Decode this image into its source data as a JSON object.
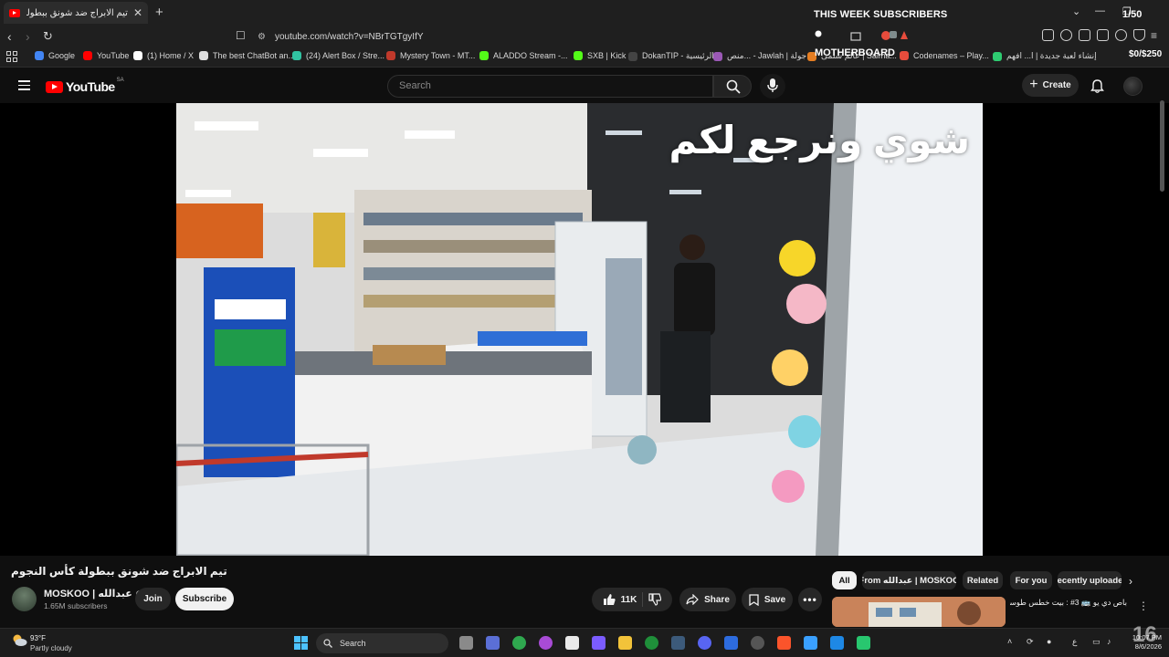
{
  "browser": {
    "tab_title": "تيم الابراج ضد شونق ببطولة كأس",
    "url": "youtube.com/watch?v=NBrTGTgyIfY",
    "bookmarks": [
      {
        "label": "Google",
        "color": "#4285f4"
      },
      {
        "label": "YouTube",
        "color": "#ff0000"
      },
      {
        "label": "(1) Home / X",
        "color": "#ffffff"
      },
      {
        "label": "The best ChatBot an...",
        "color": "#dddddd"
      },
      {
        "label": "(24) Alert Box / Stre...",
        "color": "#31c3a2"
      },
      {
        "label": "Mystery Town - MT...",
        "color": "#c0392b"
      },
      {
        "label": "ALADDO Stream -...",
        "color": "#53fc18"
      },
      {
        "label": "SXB | Kick",
        "color": "#53fc18"
      },
      {
        "label": "DokanTIP - الرئيسية",
        "color": "#444444"
      },
      {
        "label": "منص... - Jawlah | جولة",
        "color": "#9b59b6"
      },
      {
        "label": "عالم سلمى | Salma...",
        "color": "#e67e22"
      },
      {
        "label": "Codenames – Play...",
        "color": "#e74c3c"
      },
      {
        "label": "إنشاء لعبة جديدة | ا... افهم",
        "color": "#2ecc71"
      }
    ]
  },
  "overlay": {
    "title": "THIS WEEK SUBSCRIBERS",
    "count": "1/50",
    "brand": "MOTHERBOARD",
    "goal": "$0/$250"
  },
  "yt_header": {
    "logo": "YouTube",
    "country": "SA",
    "search_placeholder": "Search",
    "create_label": "Create"
  },
  "video": {
    "caption": "شوي ونرجع لكم"
  },
  "watch": {
    "title": "تيم الابراج ضد شونق ببطولة كأس النجوم",
    "channel_name": "MOSKOO | عبدالله",
    "subscribers": "1.65M subscribers",
    "join_label": "Join",
    "subscribe_label": "Subscribe",
    "likes": "11K",
    "share_label": "Share",
    "save_label": "Save"
  },
  "chips": [
    {
      "label": "All",
      "active": true
    },
    {
      "label": "From عبدالله | MOSKOO",
      "active": false
    },
    {
      "label": "Related",
      "active": false
    },
    {
      "label": "For you",
      "active": false
    },
    {
      "label": "Recently uploaded",
      "active": false
    }
  ],
  "recommendation": {
    "title": "باص دي يو 🚌 3# : بيت خطس طوسا"
  },
  "taskbar": {
    "temperature": "93°F",
    "condition": "Partly cloudy",
    "search_label": "Search",
    "time": "10:07 PM",
    "date": "8/6/2026",
    "lang": "ع",
    "corner_number": "16"
  }
}
